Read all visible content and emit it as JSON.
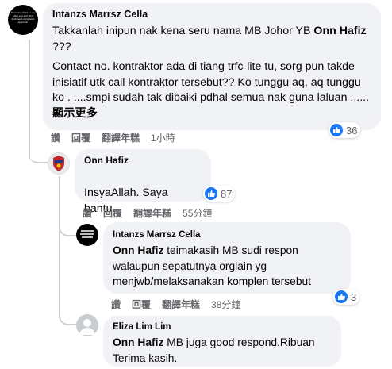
{
  "comments": [
    {
      "author": "Intanzs Marrsz Cella",
      "avatar_text": "Never be afraid to say what you feel. You don't need everyone's approval.",
      "line1_prefix": "Takkanlah inipun nak kena seru nama MB Johor YB ",
      "line1_mention": "Onn Hafiz",
      "line2_suffix": " ???",
      "paragraph": "Contact no. kontraktor ada di tiang trfc-lite tu, sorg pun takde inisiatif utk call kontraktor tersebut?? Ko tunggu aq, aq tunggu ko . ....smpi sudah tak dibaiki pdhal semua nak guna laluan ...... ",
      "see_more": "顯示更多",
      "like_label": "讚",
      "reply_label": "回覆",
      "translate_label": "翻譯年糕",
      "time": "1小時",
      "reaction_count": "36"
    },
    {
      "author": "Onn Hafiz",
      "text": "InsyaAllah. Saya bantu.",
      "like_label": "讚",
      "reply_label": "回覆",
      "translate_label": "翻譯年糕",
      "time": "55分鐘",
      "reaction_count": "87"
    },
    {
      "author": "Intanzs Marrsz Cella",
      "mention": "Onn Hafiz",
      "text_after_mention": " teimakasih MB sudi respon walaupun sepatutnya orglain yg menjwb/melaksanakan komplen tersebut",
      "like_label": "讚",
      "reply_label": "回覆",
      "translate_label": "翻譯年糕",
      "time": "38分鐘",
      "reaction_count": "3"
    },
    {
      "author": "Eliza Lim Lim",
      "mention": "Onn Hafiz",
      "text_after_mention": " MB juga good respond.Ribuan Terima kasih."
    }
  ],
  "colors": {
    "like_blue": "#1877f2",
    "bubble": "#f0f2f5",
    "meta": "#65676b"
  }
}
